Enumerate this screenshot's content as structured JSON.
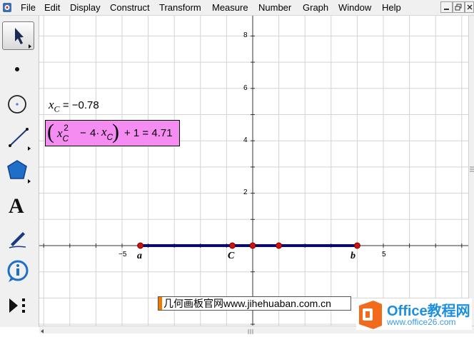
{
  "menu": {
    "items": [
      "File",
      "Edit",
      "Display",
      "Construct",
      "Transform",
      "Measure",
      "Number",
      "Graph",
      "Window",
      "Help"
    ]
  },
  "window_controls": [
    "minimize-icon",
    "restore-icon",
    "close-icon"
  ],
  "toolbox": {
    "tools": [
      "arrow-select-icon",
      "point-tool-icon",
      "compass-tool-icon",
      "straightedge-tool-icon",
      "polygon-tool-icon",
      "text-tool-icon",
      "marker-tool-icon",
      "information-tool-icon",
      "custom-tools-icon"
    ],
    "text_tool_glyph": "A"
  },
  "graph": {
    "x_tick_labels": [
      "−5",
      "5"
    ],
    "y_tick_labels": [
      "8",
      "6",
      "4",
      "2"
    ],
    "y_range": [
      -2,
      8.5
    ],
    "x_range": [
      -8,
      8
    ]
  },
  "segment": {
    "color": "#0a0a6e",
    "point_color": "#cc1111",
    "endpoints": {
      "a": -4.3,
      "b": 4.0
    },
    "C": -0.78,
    "extra_points": [
      0,
      1.0
    ]
  },
  "labels": {
    "a": "a",
    "C": "C",
    "b": "b"
  },
  "readout": {
    "xc_var": "x",
    "xc_sub": "C",
    "xc_eq": "= −0.78"
  },
  "expression": {
    "var": "x",
    "sub": "C",
    "exp": "2",
    "minus": "−",
    "coef": "4·",
    "tail": "+ 1 = 4.71",
    "bg": "#f58cf2"
  },
  "watermarks": {
    "site": "几何画板官网www.jihehuaban.com.cn",
    "office_title": "Office教程网",
    "office_url": "www.office26.com"
  }
}
